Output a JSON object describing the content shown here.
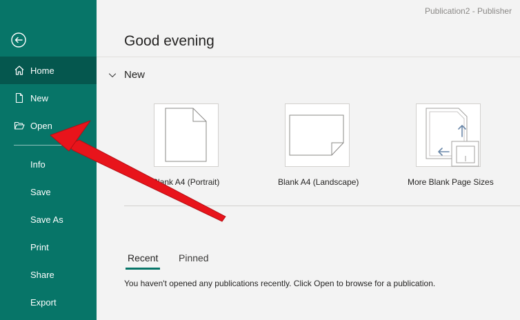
{
  "window": {
    "title": "Publication2  -  Publisher"
  },
  "sidebar": {
    "back_icon": "back-arrow-circle-icon",
    "items": [
      {
        "label": "Home",
        "icon": "home-icon",
        "active": true
      },
      {
        "label": "New",
        "icon": "new-document-icon"
      },
      {
        "label": "Open",
        "icon": "folder-open-icon"
      },
      {
        "label": "Info"
      },
      {
        "label": "Save"
      },
      {
        "label": "Save As"
      },
      {
        "label": "Print"
      },
      {
        "label": "Share"
      },
      {
        "label": "Export"
      }
    ]
  },
  "main": {
    "greeting": "Good evening",
    "new_section": {
      "label": "New",
      "templates": [
        {
          "label": "Blank A4 (Portrait)"
        },
        {
          "label": "Blank A4 (Landscape)"
        },
        {
          "label": "More Blank Page Sizes"
        }
      ]
    },
    "tabs": [
      {
        "label": "Recent",
        "selected": true
      },
      {
        "label": "Pinned"
      }
    ],
    "empty_message": "You haven't opened any publications recently. Click Open to browse for a publication."
  },
  "colors": {
    "sidebar": "#077568",
    "sidebar_active": "#05574e",
    "annotation_arrow": "#e8141b"
  }
}
